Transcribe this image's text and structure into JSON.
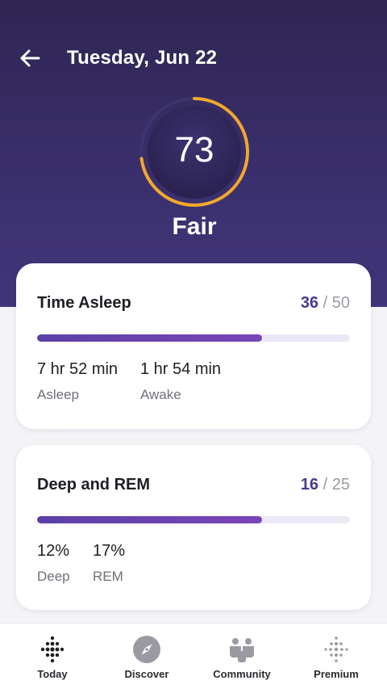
{
  "header": {
    "title": "Tuesday, Jun 22",
    "back_icon": "arrow-left-icon"
  },
  "score": {
    "value": "73",
    "label": "Fair",
    "fraction": 0.73,
    "ring_color": "#f2a82c"
  },
  "cards": [
    {
      "title": "Time Asleep",
      "points": "36",
      "max": "50",
      "progress": 0.72,
      "stats": [
        {
          "value": "7 hr 52 min",
          "label": "Asleep"
        },
        {
          "value": "1 hr 54 min",
          "label": "Awake"
        }
      ]
    },
    {
      "title": "Deep and REM",
      "points": "16",
      "max": "25",
      "progress": 0.72,
      "stats": [
        {
          "value": "12%",
          "label": "Deep"
        },
        {
          "value": "17%",
          "label": "REM"
        }
      ]
    }
  ],
  "nav": [
    {
      "label": "Today",
      "icon": "dots-grid-icon"
    },
    {
      "label": "Discover",
      "icon": "compass-icon"
    },
    {
      "label": "Community",
      "icon": "people-icon"
    },
    {
      "label": "Premium",
      "icon": "dots-sparkle-icon"
    }
  ],
  "colors": {
    "hero": "#3a2f6c",
    "accent": "#4a3a8e",
    "progress": "#6a3fb0"
  }
}
